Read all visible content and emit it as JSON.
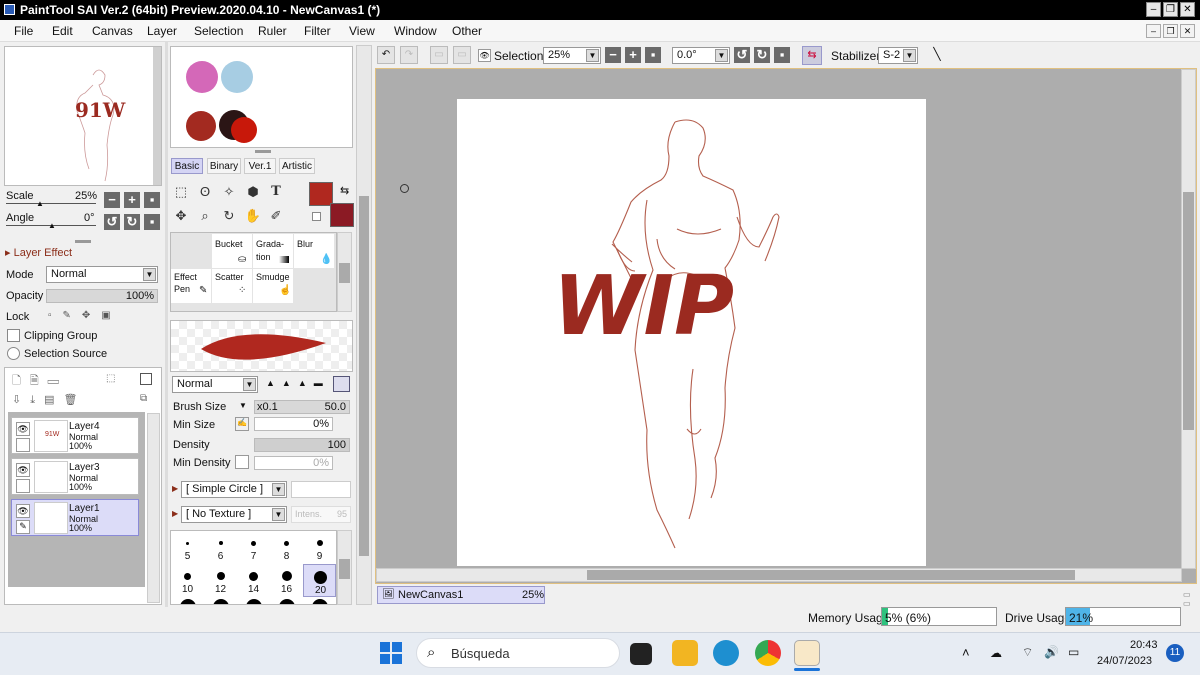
{
  "window": {
    "title": "PaintTool SAI Ver.2 (64bit) Preview.2020.04.10 - NewCanvas1 (*)"
  },
  "menu": [
    "File",
    "Edit",
    "Canvas",
    "Layer",
    "Selection",
    "Ruler",
    "Filter",
    "View",
    "Window",
    "Other"
  ],
  "navigator": {
    "scale_label": "Scale",
    "scale_value": "25%",
    "angle_label": "Angle",
    "angle_value": "0°"
  },
  "layer_effect": {
    "header": "Layer Effect",
    "mode_label": "Mode",
    "mode_value": "Normal",
    "opacity_label": "Opacity",
    "opacity_value": "100%",
    "lock_label": "Lock",
    "clipping_label": "Clipping Group",
    "selection_source_label": "Selection Source"
  },
  "layers": [
    {
      "name": "Layer4",
      "mode": "Normal",
      "opacity": "100%"
    },
    {
      "name": "Layer3",
      "mode": "Normal",
      "opacity": "100%"
    },
    {
      "name": "Layer1",
      "mode": "Normal",
      "opacity": "100%"
    }
  ],
  "palette_colors": [
    "#d468b8",
    "#a7cde3",
    "#a32a20",
    "#2b1515",
    "#c8180a"
  ],
  "primary_color": "#b0281f",
  "secondary_color": "#8b1a24",
  "tool_tabs": [
    "Basic",
    "Binary",
    "Ver.1",
    "Artistic"
  ],
  "brushes": [
    {
      "name": "Bucket",
      "line2": ""
    },
    {
      "name": "Grada-",
      "line2": "tion"
    },
    {
      "name": "Blur",
      "line2": ""
    },
    {
      "name": "Effect",
      "line2": "Pen"
    },
    {
      "name": "Scatter",
      "line2": ""
    },
    {
      "name": "Smudge",
      "line2": ""
    }
  ],
  "brush_settings": {
    "blend_mode": "Normal",
    "brush_size_label": "Brush Size",
    "brush_size_mult": "x0.1",
    "brush_size_value": "50.0",
    "min_size_label": "Min Size",
    "min_size_value": "0%",
    "density_label": "Density",
    "density_value": "100",
    "min_density_label": "Min Density",
    "min_density_value": "0%",
    "shape": "[ Simple Circle ]",
    "texture": "[ No Texture ]",
    "texture_intensity_label": "Intens.",
    "texture_intensity_value": "95"
  },
  "brush_sizes": [
    "5",
    "6",
    "7",
    "8",
    "9",
    "10",
    "12",
    "14",
    "16",
    "20"
  ],
  "toolbar": {
    "selection_label": "Selection",
    "zoom_value": "25%",
    "angle_value": "0.0°",
    "stabilizer_label": "Stabilizer",
    "stabilizer_value": "S-2"
  },
  "canvas": {
    "wip_text": "WIP"
  },
  "canvas_tab": {
    "name": "NewCanvas1",
    "zoom": "25%"
  },
  "status": {
    "memory_label": "Memory Usage",
    "memory_value": "5% (6%)",
    "memory_fraction": 0.05,
    "drive_label": "Drive Usage",
    "drive_value": "21%",
    "drive_fraction": 0.21
  },
  "taskbar": {
    "search_placeholder": "Búsqueda",
    "time": "20:43",
    "date": "24/07/2023",
    "notifications": "11"
  }
}
